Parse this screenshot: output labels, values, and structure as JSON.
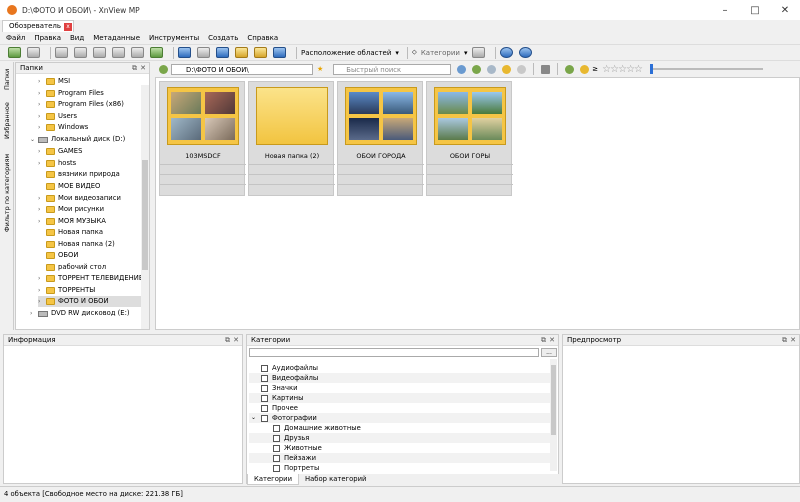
{
  "window": {
    "title": "D:\\ФОТО И ОБОИ\\ - XnView MP"
  },
  "tab": {
    "label": "Обозреватель",
    "close": "x"
  },
  "menu": [
    "Файл",
    "Правка",
    "Вид",
    "Метаданные",
    "Инструменты",
    "Создать",
    "Справка"
  ],
  "toolbar": {
    "layout_label": "Расположение областей",
    "categories_label": "Категории"
  },
  "side_tabs": [
    "Папки",
    "Избранное",
    "Фильтр по категориям"
  ],
  "folders_panel": {
    "title": "Папки",
    "items": [
      {
        "label": "MSI",
        "icon": "folder-icon"
      },
      {
        "label": "Program Files",
        "icon": "folder-icon"
      },
      {
        "label": "Program Files (x86)",
        "icon": "folder-icon"
      },
      {
        "label": "Users",
        "icon": "folder-icon"
      },
      {
        "label": "Windows",
        "icon": "folder-icon"
      },
      {
        "label": "Локальный диск (D:)",
        "icon": "drive-icon"
      },
      {
        "label": "GAMES",
        "icon": "folder-icon"
      },
      {
        "label": "hosts",
        "icon": "folder-icon"
      },
      {
        "label": "вязники природа",
        "icon": "folder-icon"
      },
      {
        "label": "МОЕ ВИДЕО",
        "icon": "folder-icon"
      },
      {
        "label": "Мои видеозаписи",
        "icon": "folder-icon"
      },
      {
        "label": "Мои рисунки",
        "icon": "folder-icon"
      },
      {
        "label": "МОЯ МУЗЫКА",
        "icon": "folder-icon"
      },
      {
        "label": "Новая папка",
        "icon": "folder-icon"
      },
      {
        "label": "Новая папка (2)",
        "icon": "folder-icon"
      },
      {
        "label": "ОБОИ",
        "icon": "folder-icon"
      },
      {
        "label": "рабочий стол",
        "icon": "folder-icon"
      },
      {
        "label": "ТОРРЕНТ ТЕЛЕВИДЕНИЕ",
        "icon": "folder-icon"
      },
      {
        "label": "ТОРРЕНТЫ",
        "icon": "folder-icon"
      },
      {
        "label": "ФОТО И ОБОИ",
        "icon": "folder-icon"
      },
      {
        "label": "DVD RW дисковод (E:)",
        "icon": "dvd-icon"
      }
    ]
  },
  "address": {
    "path": "D:\\ФОТО И ОБОИ\\",
    "search_placeholder": "Быстрый поиск"
  },
  "thumbnails": [
    {
      "label": "103MSDCF",
      "kind": "photos"
    },
    {
      "label": "Новая папка (2)",
      "kind": "empty"
    },
    {
      "label": "ОБОИ ГОРОДА",
      "kind": "city"
    },
    {
      "label": "ОБОИ ГОРЫ",
      "kind": "mountains"
    }
  ],
  "info_panel": {
    "title": "Информация"
  },
  "categories_panel": {
    "title": "Категории",
    "items": [
      "Аудиофайлы",
      "Видеофайлы",
      "Значки",
      "Картины",
      "Прочее",
      "Фотографии",
      "Домашние животные",
      "Друзья",
      "Животные",
      "Пейзажи",
      "Портреты"
    ],
    "tabs": [
      "Категории",
      "Набор категорий"
    ],
    "button": "..."
  },
  "preview_panel": {
    "title": "Предпросмотр"
  },
  "status": {
    "text": "4 объекта [Свободное место на диске: 221.38 ГБ]"
  }
}
